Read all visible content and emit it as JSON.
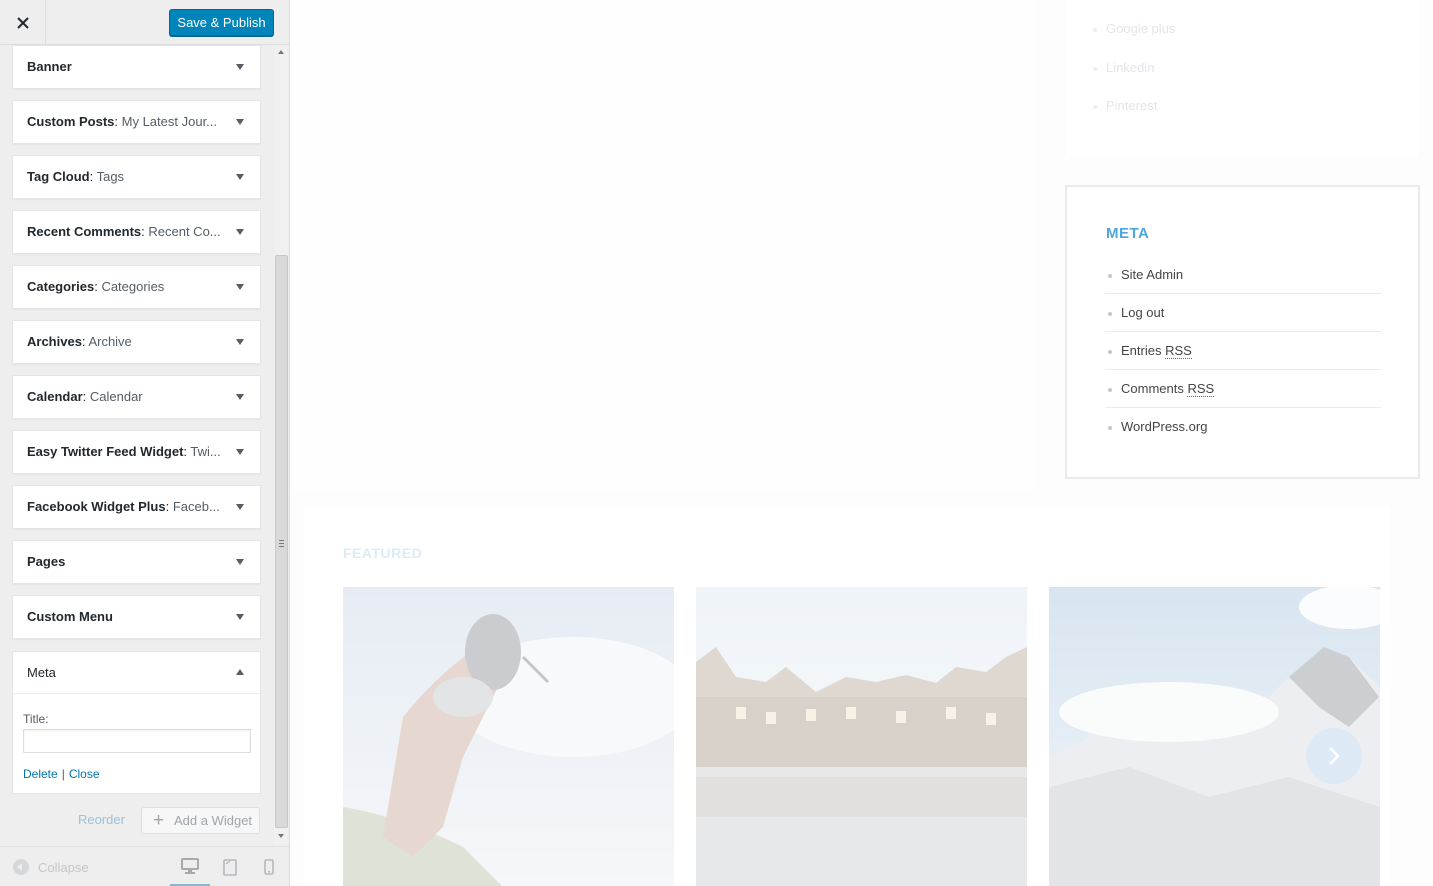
{
  "header": {
    "publish_label": "Save & Publish"
  },
  "widgets": [
    {
      "name": "Banner",
      "sub": ""
    },
    {
      "name": "Custom Posts",
      "sub": "My Latest Jour..."
    },
    {
      "name": "Tag Cloud",
      "sub": "Tags"
    },
    {
      "name": "Recent Comments",
      "sub": "Recent Co..."
    },
    {
      "name": "Categories",
      "sub": "Categories"
    },
    {
      "name": "Archives",
      "sub": "Archive"
    },
    {
      "name": "Calendar",
      "sub": "Calendar"
    },
    {
      "name": "Easy Twitter Feed Widget",
      "sub": "Twi..."
    },
    {
      "name": "Facebook Widget Plus",
      "sub": "Faceb..."
    },
    {
      "name": "Pages",
      "sub": ""
    },
    {
      "name": "Custom Menu",
      "sub": ""
    }
  ],
  "open_widget": {
    "name": "Meta",
    "title_label": "Title:",
    "title_value": "",
    "delete_label": "Delete",
    "separator": "|",
    "close_label": "Close"
  },
  "widget_actions": {
    "reorder_label": "Reorder",
    "add_widget_label": "Add a Widget"
  },
  "footer": {
    "collapse_label": "Collapse",
    "devices": [
      "desktop-icon",
      "tablet-icon",
      "mobile-icon"
    ],
    "active_device": "desktop"
  },
  "preview": {
    "social_links": [
      "Google plus",
      "Linkedin",
      "Pinterest"
    ],
    "meta_widget": {
      "title": "META",
      "links": [
        {
          "text": "Site Admin"
        },
        {
          "text": "Log out"
        },
        {
          "text": "Entries ",
          "abbr": "RSS"
        },
        {
          "text": "Comments ",
          "abbr": "RSS"
        },
        {
          "text": "WordPress.org"
        }
      ]
    },
    "featured_title": "FEATURED"
  },
  "colors": {
    "primary_button": "#0085ba",
    "link": "#0073aa",
    "meta_title": "#4fa6dc"
  }
}
